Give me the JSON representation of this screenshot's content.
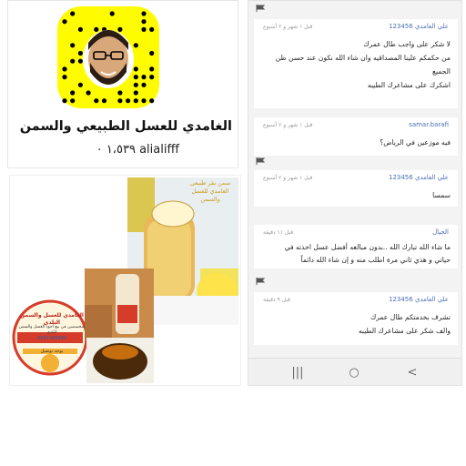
{
  "snapcode": {
    "name": "الغامدي للعسل الطبيعي والسمن",
    "username": "١،٥٣٩ ٠ alialifff",
    "colors": {
      "bg": "#fffc00",
      "dots": "#000000"
    }
  },
  "chat": {
    "messages": [
      {
        "user": "علي الغامدي 123456",
        "time": "قبل ١ شهر و ٢ أسبوع",
        "lines": [
          "لا شكر على واجب طال عمرك",
          "من حكمكم علينا المصداقيه وان شاء الله نكون عند حسن ظن",
          "الجميع",
          "اشكرك على مشاعرك الطيبه"
        ]
      },
      {
        "user": "samar.barafi",
        "time": "قبل ١ شهر و ٢ أسبوع",
        "lines": [
          "فيه موزعين في الرياض؟"
        ]
      },
      {
        "user": "علي الغامدي 123456",
        "time": "قبل ١ شهر و ٢ أسبوع",
        "lines": [
          "سمسا"
        ]
      },
      {
        "user": "الجيال",
        "time": "قبل ١١ دقيقة",
        "lines": [
          "ما شاء الله تبارك الله ..بدون مبالغه أفضل عسل اخذته في",
          "حياتي و هذي ثاني مرة اطلب منه و إن شاء الله دائماً"
        ]
      },
      {
        "user": "علي الغامدي 123456",
        "time": "قبل ٩ دقيقة",
        "lines": [
          "تشرف بخدمتكم طال عمرك",
          "والف شكر على مشاعرك الطيبه"
        ]
      }
    ],
    "nav": {
      "recent": "|||",
      "home": "○",
      "back": "<"
    }
  },
  "products": {
    "jar_label": "سمن بقر طبيعي الغامدي للعسل والسمن",
    "logo_title": "الغامدي للعسل والسمن البلدي",
    "logo_sub": "متخصصين في بيع أجود العسل والسمن البلدي",
    "phone": "0547343404",
    "delivery": "يوجد توصيل"
  }
}
